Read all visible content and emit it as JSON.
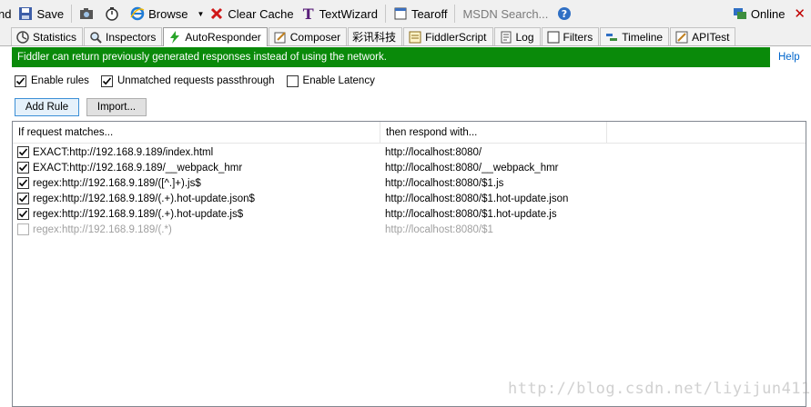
{
  "toolbar": {
    "cut_label": "nd",
    "save_label": "Save",
    "browse_label": "Browse",
    "clear_cache_label": "Clear Cache",
    "textwizard_label": "TextWizard",
    "tearoff_label": "Tearoff",
    "search_placeholder": "MSDN Search...",
    "online_label": "Online"
  },
  "tabs": [
    {
      "label": "Statistics",
      "icon": "statistics-icon"
    },
    {
      "label": "Inspectors",
      "icon": "inspectors-icon"
    },
    {
      "label": "AutoResponder",
      "icon": "lightning-icon",
      "active": true
    },
    {
      "label": "Composer",
      "icon": "composer-icon"
    },
    {
      "label": "彩讯科技"
    },
    {
      "label": "FiddlerScript",
      "icon": "script-icon"
    },
    {
      "label": "Log",
      "icon": "log-icon"
    },
    {
      "label": "Filters",
      "icon": "filters-icon"
    },
    {
      "label": "Timeline",
      "icon": "timeline-icon"
    },
    {
      "label": "APITest",
      "icon": "apitest-icon"
    }
  ],
  "banner": {
    "text": "Fiddler can return previously generated responses instead of using the network.",
    "help": "Help",
    "color": "#0a8a0a"
  },
  "options": {
    "enable_rules": {
      "label": "Enable rules",
      "checked": true
    },
    "passthrough": {
      "label": "Unmatched requests passthrough",
      "checked": true
    },
    "latency": {
      "label": "Enable Latency",
      "checked": false
    }
  },
  "buttons": {
    "add_rule": "Add Rule",
    "import": "Import..."
  },
  "table": {
    "headers": [
      "If request matches...",
      "then respond with..."
    ],
    "rows": [
      {
        "enabled": true,
        "match": "EXACT:http://192.168.9.189/index.html",
        "respond": "http://localhost:8080/"
      },
      {
        "enabled": true,
        "match": "EXACT:http://192.168.9.189/__webpack_hmr",
        "respond": "http://localhost:8080/__webpack_hmr"
      },
      {
        "enabled": true,
        "match": "regex:http://192.168.9.189/([^.]+).js$",
        "respond": "http://localhost:8080/$1.js"
      },
      {
        "enabled": true,
        "match": "regex:http://192.168.9.189/(.+).hot-update.json$",
        "respond": "http://localhost:8080/$1.hot-update.json"
      },
      {
        "enabled": true,
        "match": "regex:http://192.168.9.189/(.+).hot-update.js$",
        "respond": "http://localhost:8080/$1.hot-update.js"
      },
      {
        "enabled": false,
        "match": "regex:http://192.168.9.189/(.*)",
        "respond": "http://localhost:8080/$1"
      }
    ]
  },
  "watermark": "http://blog.csdn.net/liyijun4114"
}
